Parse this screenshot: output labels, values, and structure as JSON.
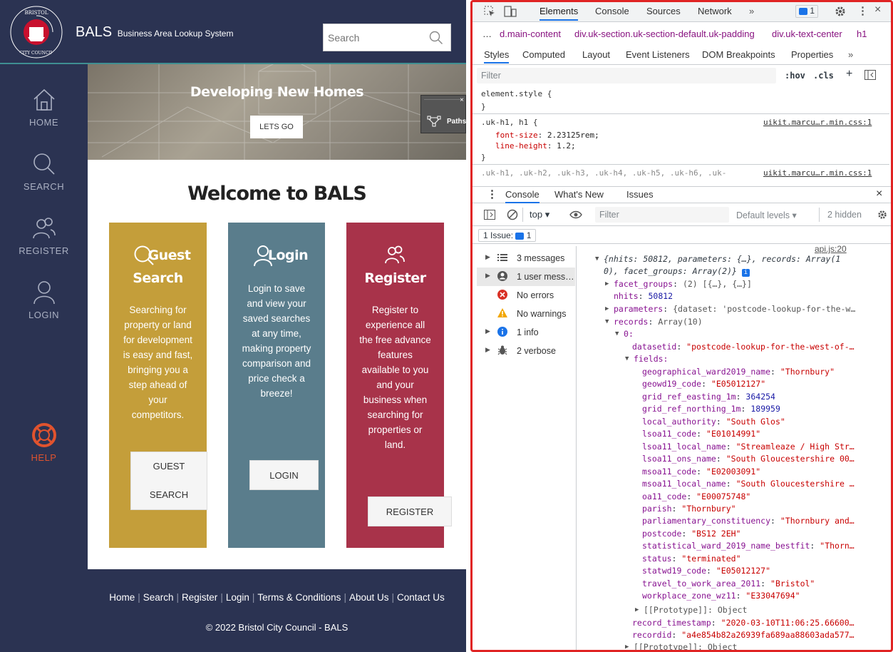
{
  "site": {
    "brand": "BALS",
    "brand_sub": "Business Area Lookup System",
    "logo_text": "BRISTOL CITY COUNCIL",
    "search_placeholder": "Search",
    "nav": [
      {
        "label": "HOME",
        "icon": "home-icon"
      },
      {
        "label": "SEARCH",
        "icon": "search-icon"
      },
      {
        "label": "REGISTER",
        "icon": "users-icon"
      },
      {
        "label": "LOGIN",
        "icon": "user-icon"
      },
      {
        "label": "HELP",
        "icon": "lifebuoy-icon"
      }
    ],
    "hero": {
      "title": "Developing New Homes",
      "button": "LETS GO"
    },
    "paths_panel": {
      "label": "Paths",
      "close": "×"
    },
    "welcome": "Welcome to BALS",
    "cards": {
      "guest": {
        "title_1": "Guest",
        "title_2": "Search",
        "desc": "Searching for property or land for development is easy and fast, bringing you a step ahead of your competitors.",
        "button_1": "GUEST",
        "button_2": "SEARCH"
      },
      "login": {
        "title": "Login",
        "desc": "Login to save and view your saved searches at any time, making property comparison and price check a breeze!",
        "button": "LOGIN"
      },
      "register": {
        "title": "Register",
        "desc": "Register to experience all the free advance features available to you and your business when searching for properties or land.",
        "button": "REGISTER"
      }
    },
    "footer": {
      "links": [
        "Home",
        "Search",
        "Register",
        "Login",
        "Terms & Conditions",
        "About Us",
        "Contact Us"
      ],
      "copyright": "© 2022 Bristol City Council - BALS"
    }
  },
  "devtools": {
    "tabs": [
      "Elements",
      "Console",
      "Sources",
      "Network"
    ],
    "issue_badge": "1",
    "breadcrumb": [
      "d.main-content",
      "div.uk-section.uk-section-default.uk-padding",
      "div.uk-text-center",
      "h1"
    ],
    "subtabs": [
      "Styles",
      "Computed",
      "Layout",
      "Event Listeners",
      "DOM Breakpoints",
      "Properties"
    ],
    "filter_placeholder": "Filter",
    "hov": ":hov",
    "cls": ".cls",
    "styles": {
      "element_style": "element.style {",
      "close_brace": "}",
      "rule1_selector": ".uk-h1, h1 {",
      "rule1_source": "uikit.marcu…r.min.css:1",
      "rule1_prop1": "font-size",
      "rule1_val1": "2.23125rem;",
      "rule1_prop2": "line-height",
      "rule1_val2": "1.2;",
      "rule2_selector": ".uk-h1, .uk-h2, .uk-h3, .uk-h4, .uk-h5, .uk-h6, .uk-",
      "rule2_source": "uikit.marcu…r.min.css:1"
    },
    "drawer_tabs": [
      "Console",
      "What's New",
      "Issues"
    ],
    "console_toolbar": {
      "context": "top",
      "filter": "Filter",
      "levels": "Default levels",
      "hidden": "2 hidden"
    },
    "issues_label": "1 Issue:",
    "issues_count": "1",
    "sidebar": [
      {
        "label": "3 messages",
        "icon": "list-icon"
      },
      {
        "label": "1 user mess…",
        "icon": "user-circle-icon"
      },
      {
        "label": "No errors",
        "icon": "error-icon"
      },
      {
        "label": "No warnings",
        "icon": "warning-icon"
      },
      {
        "label": "1 info",
        "icon": "info-icon"
      },
      {
        "label": "2 verbose",
        "icon": "bug-icon"
      }
    ],
    "output": {
      "source": "api.js:20",
      "l1": "{nhits: 50812, parameters: {…}, records: Array(1",
      "l2": "0), facet_groups: Array(2)}",
      "facet_groups_key": "facet_groups",
      "facet_groups_val": "(2) [{…}, {…}]",
      "nhits_key": "nhits",
      "nhits_val": "50812",
      "parameters_key": "parameters",
      "parameters_val": "{dataset: 'postcode-lookup-for-the-w…",
      "records_key": "records",
      "records_val": "Array(10)",
      "index0": "0",
      "datasetid_key": "datasetid",
      "datasetid_val": "\"postcode-lookup-for-the-west-of-…",
      "fields_key": "fields",
      "fields": [
        {
          "k": "geographical_ward2019_name",
          "v": "\"Thornbury\"",
          "t": "s"
        },
        {
          "k": "geowd19_code",
          "v": "\"E05012127\"",
          "t": "s"
        },
        {
          "k": "grid_ref_easting_1m",
          "v": "364254",
          "t": "n"
        },
        {
          "k": "grid_ref_northing_1m",
          "v": "189959",
          "t": "n"
        },
        {
          "k": "local_authority",
          "v": "\"South Glos\"",
          "t": "s"
        },
        {
          "k": "lsoa11_code",
          "v": "\"E01014991\"",
          "t": "s"
        },
        {
          "k": "lsoa11_local_name",
          "v": "\"Streamleaze / High Str…",
          "t": "s"
        },
        {
          "k": "lsoa11_ons_name",
          "v": "\"South Gloucestershire 00…",
          "t": "s"
        },
        {
          "k": "msoa11_code",
          "v": "\"E02003091\"",
          "t": "s"
        },
        {
          "k": "msoa11_local_name",
          "v": "\"South Gloucestershire …",
          "t": "s"
        },
        {
          "k": "oa11_code",
          "v": "\"E00075748\"",
          "t": "s"
        },
        {
          "k": "parish",
          "v": "\"Thornbury\"",
          "t": "s"
        },
        {
          "k": "parliamentary_constituency",
          "v": "\"Thornbury and…",
          "t": "s"
        },
        {
          "k": "postcode",
          "v": "\"BS12 2EH\"",
          "t": "s"
        },
        {
          "k": "statistical_ward_2019_name_bestfit",
          "v": "\"Thorn…",
          "t": "s"
        },
        {
          "k": "status",
          "v": "\"terminated\"",
          "t": "s"
        },
        {
          "k": "statwd19_code",
          "v": "\"E05012127\"",
          "t": "s"
        },
        {
          "k": "travel_to_work_area_2011",
          "v": "\"Bristol\"",
          "t": "s"
        },
        {
          "k": "workplace_zone_wz11",
          "v": "\"E33047694\"",
          "t": "s"
        }
      ],
      "proto1": "[[Prototype]]: Object",
      "record_timestamp_key": "record_timestamp",
      "record_timestamp_val": "\"2020-03-10T11:06:25.66600…",
      "recordid_key": "recordid",
      "recordid_val": "\"a4e854b82a26939fa689aa88603ada577…",
      "proto2": "[[Prototype]]: Object"
    }
  }
}
